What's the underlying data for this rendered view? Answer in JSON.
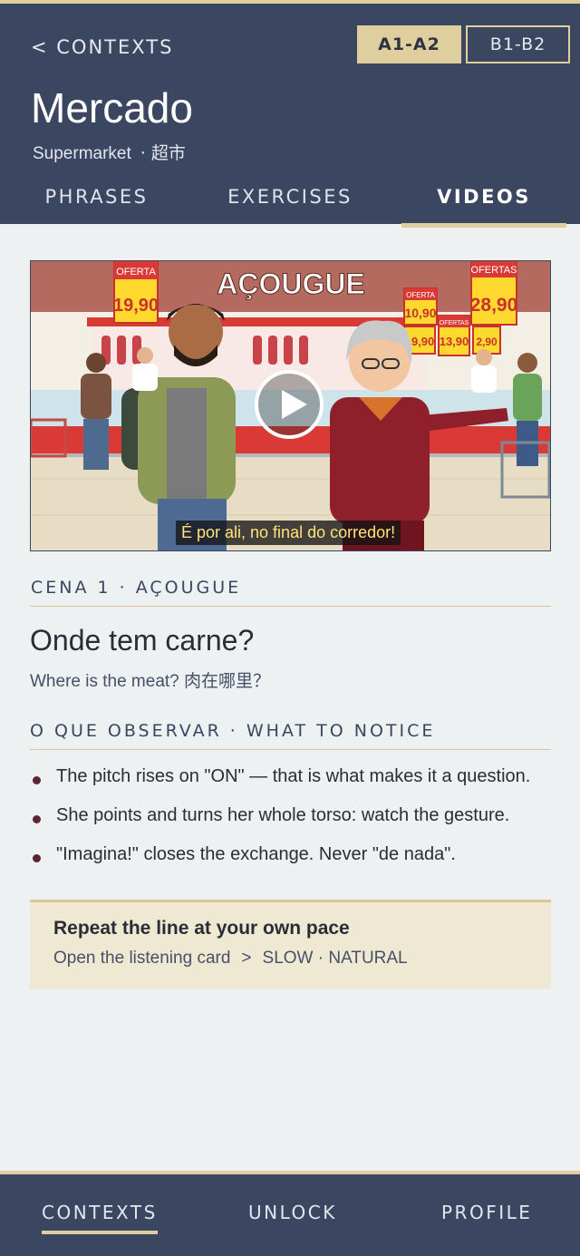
{
  "header": {
    "back_label": "< CONTEXTS",
    "levels": [
      "A1-A2",
      "B1-B2"
    ],
    "title": "Mercado",
    "subtitle_en": "Supermarket",
    "subtitle_zh": "· 超市",
    "tabs": [
      "PHRASES",
      "EXERCISES",
      "VIDEOS"
    ],
    "active_tab": "VIDEOS"
  },
  "video": {
    "sign_title": "AÇOUGUE",
    "price_tags": [
      {
        "label": "OFERTA",
        "price": "19,90"
      },
      {
        "label": "OFERTA",
        "price": "10,90"
      },
      {
        "label": "OFERTAS",
        "price": "13,90"
      },
      {
        "label": "OFERTAS",
        "price": "28,90"
      },
      {
        "label": "",
        "price": "19,90"
      },
      {
        "label": "",
        "price": "2,90"
      }
    ],
    "caption": "É por ali, no final do corredor!",
    "play_icon": "play-icon"
  },
  "scene": {
    "label": "CENA 1 · AÇOUGUE",
    "phrase": "Onde tem carne?",
    "translation_en": "Where is the meat?",
    "translation_zh": "肉在哪里？"
  },
  "notice": {
    "label": "O QUE OBSERVAR · WHAT TO NOTICE",
    "items": [
      "The pitch rises on \"ON\" — that is what makes it a question.",
      "She points and turns her whole torso: watch the gesture.",
      "\"Imagina!\" closes the exchange. Never \"de nada\"."
    ]
  },
  "practice": {
    "title": "Repeat the line at your own pace",
    "link_text": "Open the listening card",
    "arrow": ">",
    "speeds": "SLOW · NATURAL"
  },
  "bottom_nav": {
    "items": [
      "CONTEXTS",
      "UNLOCK",
      "PROFILE"
    ],
    "active": "CONTEXTS"
  },
  "colors": {
    "navy": "#3b4660",
    "gold": "#e0cf9e",
    "background": "#edf1f2",
    "practice_card": "#efe9d4",
    "bullet": "#5a2636"
  }
}
